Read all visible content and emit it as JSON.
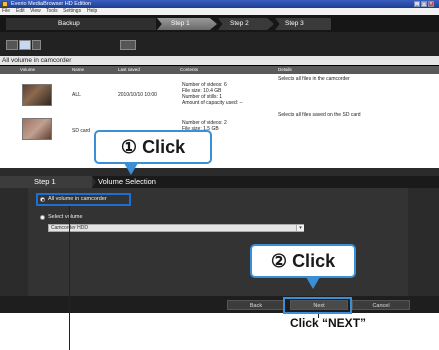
{
  "window": {
    "title": "Everio MediaBrowser HD Edition"
  },
  "menu": [
    "File",
    "Edit",
    "View",
    "Tools",
    "Settings",
    "Help"
  ],
  "steps": {
    "backup": "Backup",
    "step1": "Step 1",
    "step2": "Step 2",
    "step3": "Step 3"
  },
  "list": {
    "title": "All volume in camcorder",
    "columns": [
      "Volume",
      "Name",
      "Last saved",
      "Contents",
      "Details"
    ],
    "rows": [
      {
        "name": "ALL",
        "date": "2010/10/10 10:00",
        "contents": [
          "Number of videos: 6",
          "File size: 10.4 GB",
          "Number of stills: 1",
          "Amount of capacity used: --"
        ],
        "details": "Selects all files in the camcorder"
      },
      {
        "name": "SD card",
        "date": "",
        "contents": [
          "Number of videos: 2",
          "File size: 1.5 GB"
        ],
        "details": "Selects all files saved on the SD card"
      }
    ]
  },
  "callouts": {
    "click1_num": "①",
    "click1_text": "Click",
    "click2_num": "②",
    "click2_text": "Click",
    "caption_next": "Click “NEXT”"
  },
  "step_section": {
    "tab1": "Step 1",
    "tab2": "Volume Selection",
    "option_all": "All volume in camcorder",
    "option_select": "Select volume",
    "dropdown_value": "Camcorder HDD"
  },
  "buttons": {
    "back": "Back",
    "next": "Next",
    "cancel": "Cancel"
  },
  "colors": {
    "callout_border": "#3a8fd6",
    "selection_highlight": "#1e6fd0"
  }
}
